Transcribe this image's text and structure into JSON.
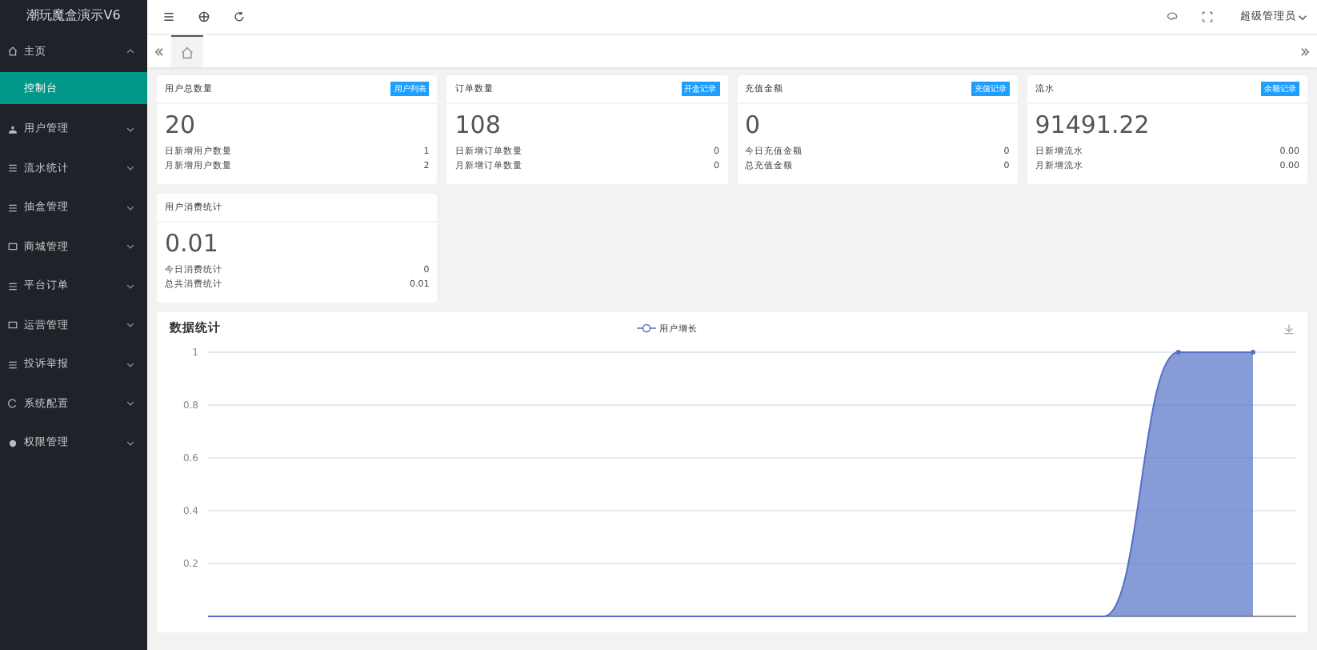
{
  "sidebar": {
    "title": "潮玩魔盒演示V6",
    "items": [
      {
        "label": "主页",
        "kind": "home",
        "expanded": true,
        "selected": false,
        "children": [
          {
            "label": "控制台",
            "selected": true
          }
        ]
      },
      {
        "label": "用户管理",
        "kind": "user",
        "expanded": false,
        "selected": false
      },
      {
        "label": "流水统计",
        "kind": "list",
        "expanded": false,
        "selected": false
      },
      {
        "label": "抽盒管理",
        "kind": "list",
        "expanded": false,
        "selected": false
      },
      {
        "label": "商城管理",
        "kind": "box",
        "expanded": false,
        "selected": false
      },
      {
        "label": "平台订单",
        "kind": "list",
        "expanded": false,
        "selected": false
      },
      {
        "label": "运营管理",
        "kind": "box",
        "expanded": false,
        "selected": false
      },
      {
        "label": "投诉举报",
        "kind": "list",
        "expanded": false,
        "selected": false
      },
      {
        "label": "系统配置",
        "kind": "cycle",
        "expanded": false,
        "selected": false
      },
      {
        "label": "权限管理",
        "kind": "gear",
        "expanded": false,
        "selected": false
      }
    ]
  },
  "header": {
    "user": "超级管理员"
  },
  "cards": [
    {
      "title": "用户总数量",
      "tag": "用户列表",
      "value": "20",
      "rows": [
        {
          "label": "日新增用户数量",
          "value": "1"
        },
        {
          "label": "月新增用户数量",
          "value": "2"
        }
      ]
    },
    {
      "title": "订单数量",
      "tag": "开盒记录",
      "value": "108",
      "rows": [
        {
          "label": "日新增订单数量",
          "value": "0"
        },
        {
          "label": "月新增订单数量",
          "value": "0"
        }
      ]
    },
    {
      "title": "充值金额",
      "tag": "充值记录",
      "value": "0",
      "rows": [
        {
          "label": "今日充值金额",
          "value": "0"
        },
        {
          "label": "总充值金额",
          "value": "0"
        }
      ]
    },
    {
      "title": "流水",
      "tag": "余额记录",
      "value": "91491.22",
      "rows": [
        {
          "label": "日新增流水",
          "value": "0.00"
        },
        {
          "label": "月新增流水",
          "value": "0.00"
        }
      ]
    },
    {
      "title": "用户消费统计",
      "value": "0.01",
      "rows": [
        {
          "label": "今日消费统计",
          "value": "0"
        },
        {
          "label": "总共消费统计",
          "value": "0.01"
        }
      ]
    }
  ],
  "stats": {
    "title": "数据统计",
    "chart_data": {
      "type": "area",
      "grid": true,
      "ylim": [
        0,
        1
      ],
      "yticks": [
        0.2,
        0.4,
        0.6,
        0.8,
        1
      ],
      "series": [
        {
          "name": "用户增长",
          "color": "#5470c6",
          "values": [
            0,
            0,
            0,
            0,
            0,
            0,
            0,
            0,
            0,
            0,
            0,
            0,
            0,
            1,
            1
          ]
        }
      ]
    }
  }
}
